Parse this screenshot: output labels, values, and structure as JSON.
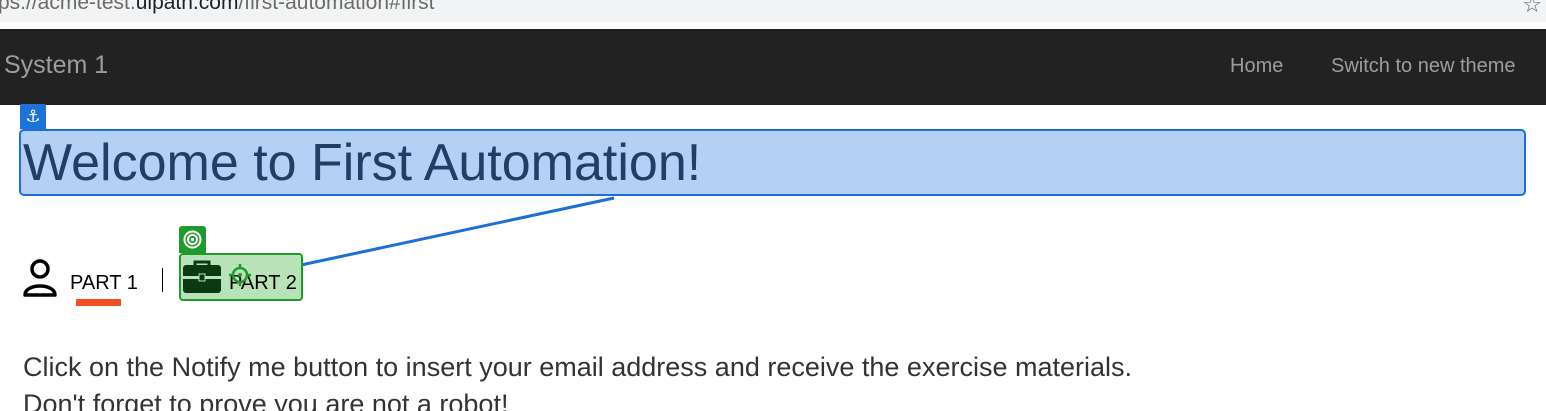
{
  "browser": {
    "url_prefix": "ps://acme-test.",
    "url_host": "uipath.com",
    "url_path": "/first-automation#first",
    "star_icon": "bookmark-star-icon"
  },
  "navbar": {
    "brand": "System 1",
    "links": [
      {
        "label": "Home"
      },
      {
        "label": "Switch to new theme"
      }
    ]
  },
  "main": {
    "title": "Welcome to First Automation!",
    "steps": [
      {
        "label": "PART 1",
        "icon": "user-icon",
        "active": true
      },
      {
        "label": "PART 2",
        "icon": "briefcase-icon",
        "active": false
      }
    ],
    "instructions": [
      "Click on the Notify me button to insert your email address and receive the exercise materials.",
      "Don't forget to prove you are not a robot!"
    ]
  },
  "overlay": {
    "anchor_icon": "anchor-icon",
    "target_icon": "target-icon",
    "anchor_color": "#1c73d9",
    "target_color": "#1e9b2a"
  },
  "colors": {
    "navbar_bg": "#222222",
    "nav_text": "#9d9d9d",
    "active_underline": "#f04e23"
  }
}
